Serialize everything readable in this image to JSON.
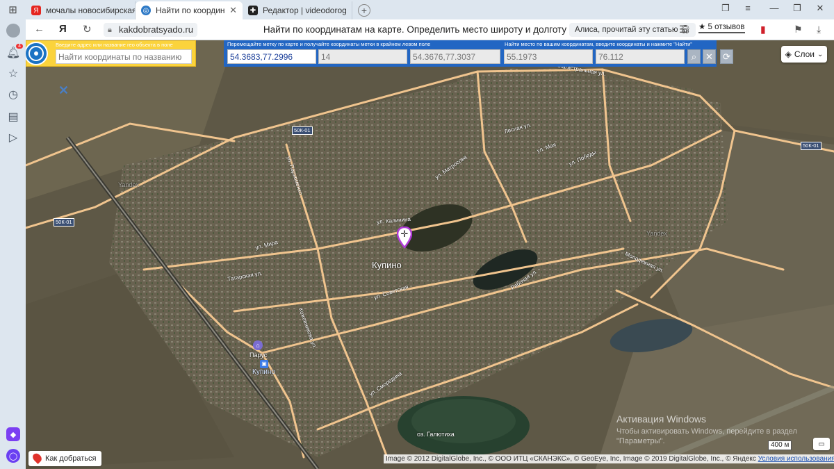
{
  "tabs": [
    {
      "label": "мочалы новосибирская о",
      "fav_color": "#e52620",
      "fav_icon": "Я",
      "active": false
    },
    {
      "label": "Найти по координатам",
      "fav_color": "#2d79c6",
      "fav_icon": "◎",
      "active": true
    },
    {
      "label": "Редактор | videodorogrosso",
      "fav_color": "#222222",
      "fav_icon": "✚",
      "active": false
    }
  ],
  "address_bar": {
    "url": "kakdobratsyado.ru",
    "page_title": "Найти по координатам на карте. Определить место широту и долготу",
    "alice_label": "Алиса, прочитай эту статью",
    "reviews_label": "★ 5 отзывов"
  },
  "sidebar": {
    "notification_count": "4"
  },
  "address_panel": {
    "label": "Введите адрес или название гео объекта в поле",
    "placeholder": "Найти координаты по названию"
  },
  "coord_panel": {
    "label_left": "Перемещайте метку по карте и получайте координаты метки в крайнем левом поле",
    "label_right": "Найти место по вашим координатам, введите координаты и нажмите \"Найти\"",
    "marker_coords": "54.3683,77.2996",
    "zoom": "14",
    "center_coords": "54.3676,77.3037",
    "lat_input": "55.1973",
    "lon_input": "76.112"
  },
  "layers_label": "Слои",
  "map": {
    "city": "Купино",
    "yandex_watermark": "Yandex",
    "highway_labels": [
      "50К-01",
      "50К-01",
      "50К-01"
    ],
    "roads": [
      "Магистральная ул.",
      "ул. Пархоменко",
      "ул. Мира",
      "Татарская ул.",
      "ул. Советская",
      "Рабочая ул.",
      "ул. Смородина",
      "Молодежная ул.",
      "ул. Матросова",
      "ул. Мая",
      "ул. Победы",
      "Лесная ул.",
      "Кожевникова ул.",
      "ул. Калинина"
    ],
    "poi_parus": "Парус",
    "poi_station": "Купино",
    "lake": "оз. Галютиха"
  },
  "route_button": "Как добраться",
  "scale_label": "400 м",
  "copyright": "Image © 2012 DigitalGlobe, Inc., © ООО ИТЦ «СКАНЭКС», © GeoEye, Inc, Image © 2019 DigitalGlobe, Inc., © Яндекс",
  "conditions_link": "Условия использования",
  "activation": {
    "title": "Активация Windows",
    "text": "Чтобы активировать Windows, перейдите в раздел \"Параметры\"."
  }
}
